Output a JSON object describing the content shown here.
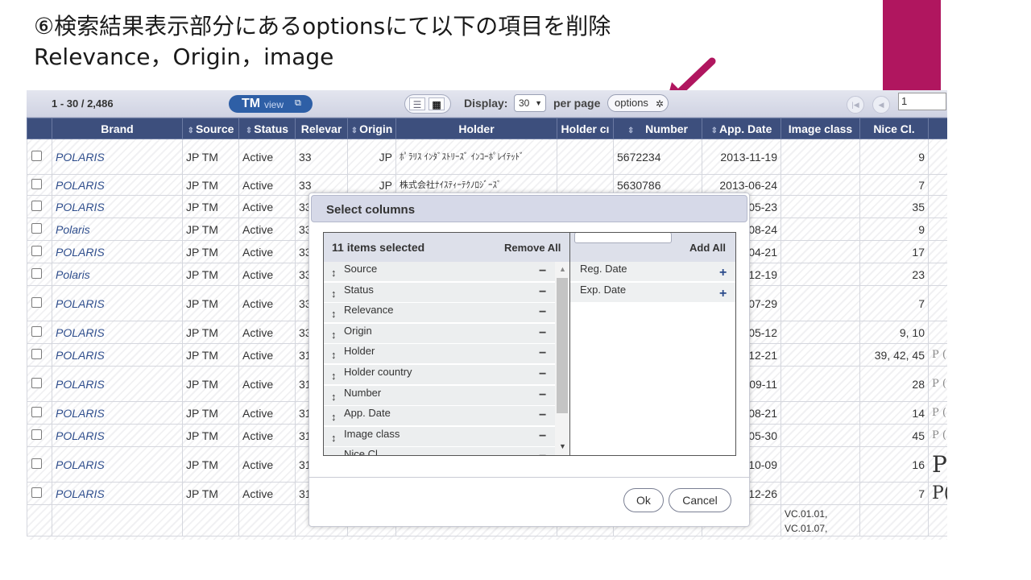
{
  "slide": {
    "title_line1": "⑥検索結果表示部分にあるoptionsにて以下の項目を削除",
    "title_line2": "Relevance，Origin，image",
    "accent_color": "#b0165f",
    "arrow_color": "#b0165f"
  },
  "toolbar": {
    "range": "1 - 30 / 2,486",
    "tmview_tm": "TM",
    "tmview_view": "view",
    "tmview_icon": "external-link-icon",
    "display_label": "Display:",
    "display_value": "30",
    "per_page_label": "per page",
    "options_label": "options",
    "page_value": "1"
  },
  "table": {
    "headers": [
      "Brand",
      "Source",
      "Status",
      "Relevar",
      "Origin",
      "Holder",
      "Holder cı",
      "Number",
      "App. Date",
      "Image class",
      "Nice Cl."
    ],
    "rows": [
      {
        "brand": "POLARIS",
        "source": "JP TM",
        "status": "Active",
        "relevance": "33",
        "origin": "JP",
        "holder": "ﾎﾟﾗﾘｽ ｲﾝﾀﾞｽﾄﾘｰｽﾞ ｲﾝｺｰﾎﾟﾚｲﾃｯﾄﾞ",
        "number": "5672234",
        "app_date": "2013-11-19",
        "image_class": "",
        "nice": "9",
        "img": ""
      },
      {
        "brand": "POLARIS",
        "source": "JP TM",
        "status": "Active",
        "relevance": "33",
        "origin": "JP",
        "holder": "株式会社ﾅｲｽﾃｨｰﾃｸﾉﾛｼﾞｰｽﾞ",
        "number": "5630786",
        "app_date": "2013-06-24",
        "image_class": "",
        "nice": "7",
        "img": ""
      },
      {
        "brand": "POLARIS",
        "source": "JP TM",
        "status": "Active",
        "relevance": "33",
        "origin": "",
        "holder": "",
        "number": "",
        "app_date": "05-23",
        "image_class": "",
        "nice": "35",
        "img": ""
      },
      {
        "brand": "Polaris",
        "source": "JP TM",
        "status": "Active",
        "relevance": "33",
        "origin": "",
        "holder": "",
        "number": "",
        "app_date": "08-24",
        "image_class": "",
        "nice": "9",
        "img": ""
      },
      {
        "brand": "POLARIS",
        "source": "JP TM",
        "status": "Active",
        "relevance": "33",
        "origin": "",
        "holder": "",
        "number": "",
        "app_date": "04-21",
        "image_class": "",
        "nice": "17",
        "img": ""
      },
      {
        "brand": "Polaris",
        "source": "JP TM",
        "status": "Active",
        "relevance": "33",
        "origin": "",
        "holder": "",
        "number": "",
        "app_date": "12-19",
        "image_class": "",
        "nice": "23",
        "img": ""
      },
      {
        "brand": "POLARIS",
        "source": "JP TM",
        "status": "Active",
        "relevance": "33",
        "origin": "",
        "holder": "",
        "number": "",
        "app_date": "07-29",
        "image_class": "",
        "nice": "7",
        "img": ""
      },
      {
        "brand": "POLARIS",
        "source": "JP TM",
        "status": "Active",
        "relevance": "33",
        "origin": "",
        "holder": "",
        "number": "",
        "app_date": "05-12",
        "image_class": "",
        "nice": "9, 10",
        "img": ""
      },
      {
        "brand": "POLARIS",
        "source": "JP TM",
        "status": "Active",
        "relevance": "31",
        "origin": "",
        "holder": "",
        "number": "",
        "app_date": "12-21",
        "image_class": "",
        "nice": "39, 42, 45",
        "img": "P ("
      },
      {
        "brand": "POLARIS",
        "source": "JP TM",
        "status": "Active",
        "relevance": "31",
        "origin": "",
        "holder": "",
        "number": "",
        "app_date": "09-11",
        "image_class": "",
        "nice": "28",
        "img": "P ("
      },
      {
        "brand": "POLARIS",
        "source": "JP TM",
        "status": "Active",
        "relevance": "31",
        "origin": "",
        "holder": "",
        "number": "",
        "app_date": "08-21",
        "image_class": "",
        "nice": "14",
        "img": "P ("
      },
      {
        "brand": "POLARIS",
        "source": "JP TM",
        "status": "Active",
        "relevance": "31",
        "origin": "",
        "holder": "",
        "number": "",
        "app_date": "05-30",
        "image_class": "",
        "nice": "45",
        "img": "P ("
      },
      {
        "brand": "POLARIS",
        "source": "JP TM",
        "status": "Active",
        "relevance": "31",
        "origin": "",
        "holder": "",
        "number": "",
        "app_date": "10-09",
        "image_class": "",
        "nice": "16",
        "img": "P"
      },
      {
        "brand": "POLARIS",
        "source": "JP TM",
        "status": "Active",
        "relevance": "31",
        "origin": "",
        "holder": "",
        "number": "",
        "app_date": "12-26",
        "image_class": "",
        "nice": "7",
        "img": "P("
      },
      {
        "brand": "",
        "source": "",
        "status": "",
        "relevance": "",
        "origin": "",
        "holder": "",
        "number": "",
        "app_date": "",
        "image_class": "VC.01.01, VC.01.07,",
        "nice": "",
        "img": ""
      }
    ]
  },
  "modal": {
    "title": "Select columns",
    "selected_count": "11 items selected",
    "remove_all": "Remove All",
    "add_all": "Add All",
    "selected_items": [
      "Source",
      "Status",
      "Relevance",
      "Origin",
      "Holder",
      "Holder country",
      "Number",
      "App. Date",
      "Image class",
      "Nice Cl."
    ],
    "available_items": [
      "Reg. Date",
      "Exp. Date"
    ],
    "remove_symbol": "−",
    "add_symbol": "+",
    "drag_symbol": "↕",
    "ok": "Ok",
    "cancel": "Cancel"
  }
}
